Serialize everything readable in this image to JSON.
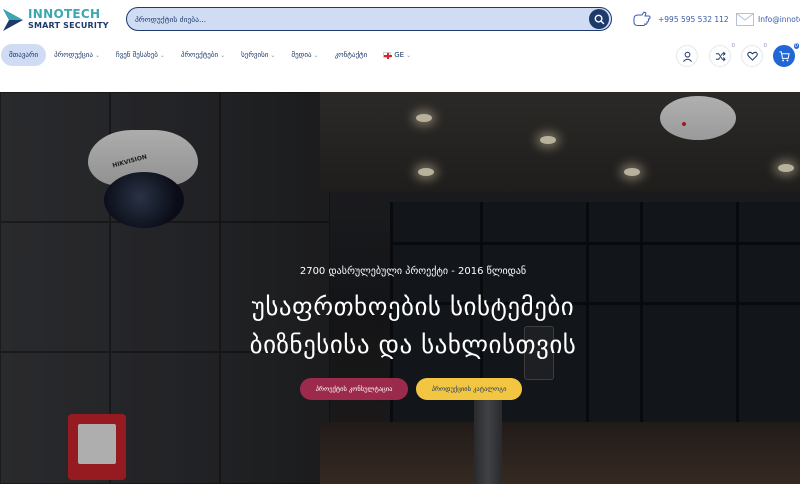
{
  "brand": {
    "name_top": "INNOTECH",
    "name_bottom": "SMART SECURITY"
  },
  "search": {
    "placeholder": "პროდუქტის ძიება..."
  },
  "contact": {
    "phone": "+995 595 532 112",
    "email": "Info@innote"
  },
  "nav": {
    "items": [
      {
        "label": "მთავარი",
        "active": true,
        "caret": false
      },
      {
        "label": "პროდუქცია",
        "caret": true
      },
      {
        "label": "ჩვენ შესახებ",
        "caret": true
      },
      {
        "label": "პროექტები",
        "caret": true
      },
      {
        "label": "სერვისი",
        "caret": true
      },
      {
        "label": "მედია",
        "caret": true
      },
      {
        "label": "კონტაქტი",
        "caret": false
      }
    ],
    "language": "GE"
  },
  "header_icons": {
    "compare_count": "0",
    "wishlist_count": "0",
    "cart_count": "0"
  },
  "hero": {
    "subtitle": "2700 დასრულებული პროექტი - 2016 წლიდან",
    "title_line1": "უსაფრთხოების სისტემები",
    "title_line2": "ბიზნესისა და სახლისთვის",
    "camera_brand": "HIKVISION",
    "button_consult": "პროექტის კონსულტაცია",
    "button_catalog": "პროდუქციის კატალოგი"
  },
  "colors": {
    "primary": "#1e3a6b",
    "accent_blue": "#2166d6",
    "consult_button": "#9c2a4c",
    "catalog_button": "#f2c641",
    "search_bg": "#cfdcf3"
  }
}
